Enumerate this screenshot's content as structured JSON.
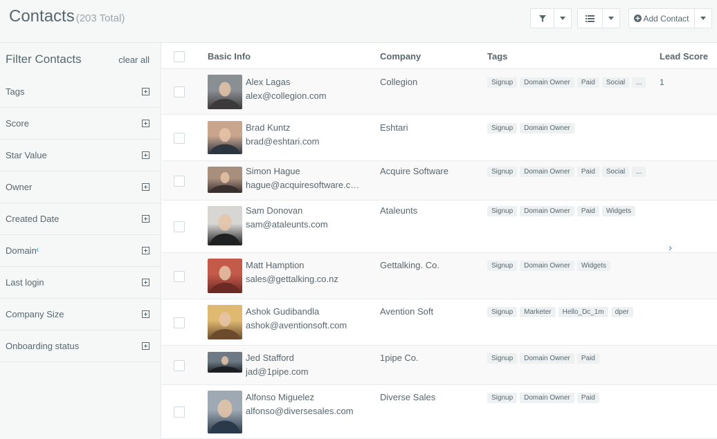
{
  "header": {
    "title": "Contacts",
    "total": "(203 Total)",
    "add_contact_label": "Add Contact"
  },
  "sidebar": {
    "heading": "Filter Contacts",
    "clear_label": "clear all",
    "filters": [
      "Tags",
      "Score",
      "Star Value",
      "Owner",
      "Created Date",
      "Domain",
      "Last login",
      "Company Size",
      "Onboarding status"
    ]
  },
  "table": {
    "columns": {
      "basic_info": "Basic Info",
      "company": "Company",
      "tags": "Tags",
      "lead_score": "Lead Score"
    },
    "rows": [
      {
        "name": "Alex Lagas",
        "email": "alex@collegion.com",
        "company": "Collegion",
        "tags": [
          "Signup",
          "Domain Owner",
          "Paid",
          "Social",
          "..."
        ],
        "score": "1",
        "avatar_colors": [
          "#8a8f94",
          "#3c3a3a"
        ]
      },
      {
        "name": "Brad Kuntz",
        "email": "brad@eshtari.com",
        "company": "Eshtari",
        "tags": [
          "Signup",
          "Domain Owner"
        ],
        "score": "",
        "avatar_colors": [
          "#c9a58e",
          "#2d3540"
        ]
      },
      {
        "name": "Simon Hague",
        "email": "hague@acquiresoftware.com",
        "company": "Acquire Software",
        "tags": [
          "Signup",
          "Domain Owner",
          "Paid",
          "Social",
          "..."
        ],
        "score": "",
        "avatar_colors": [
          "#a88f7c",
          "#3a3030"
        ]
      },
      {
        "name": "Sam Donovan",
        "email": "sam@ataleunts.com",
        "company": "Ataleunts",
        "tags": [
          "Signup",
          "Domain Owner",
          "Paid",
          "Widgets"
        ],
        "score": "",
        "avatar_colors": [
          "#d8d6d3",
          "#1f2022"
        ]
      },
      {
        "name": "Matt Hamption",
        "email": "sales@gettalking.co.nz",
        "company": "Gettalking. Co.",
        "tags": [
          "Signup",
          "Domain Owner",
          "Widgets"
        ],
        "score": "",
        "avatar_colors": [
          "#c45a4a",
          "#6b2a23"
        ]
      },
      {
        "name": "Ashok Gudibandla",
        "email": "ashok@aventionsoft.com",
        "company": "Avention Soft",
        "tags": [
          "Signup",
          "Marketer",
          "Hello_Dc_1m",
          "dper"
        ],
        "score": "",
        "avatar_colors": [
          "#e0b970",
          "#6b4a2e"
        ]
      },
      {
        "name": "Jed Stafford",
        "email": "jad@1pipe.com",
        "company": "1pipe Co.",
        "tags": [
          "Signup",
          "Domain Owner",
          "Paid"
        ],
        "score": "",
        "avatar_colors": [
          "#6d7a85",
          "#1d1f24"
        ]
      },
      {
        "name": "Alfonso Miguelez",
        "email": "alfonso@diversesales.com",
        "company": "Diverse Sales",
        "tags": [
          "Signup",
          "Domain Owner",
          "Paid"
        ],
        "score": "",
        "avatar_colors": [
          "#9ea9b3",
          "#2b3a4a"
        ]
      }
    ]
  },
  "icons": {
    "filter": "filter-icon",
    "list": "list-icon",
    "add": "plus-circle-icon",
    "prev": "chevron-left-icon",
    "next": "chevron-right-icon"
  }
}
